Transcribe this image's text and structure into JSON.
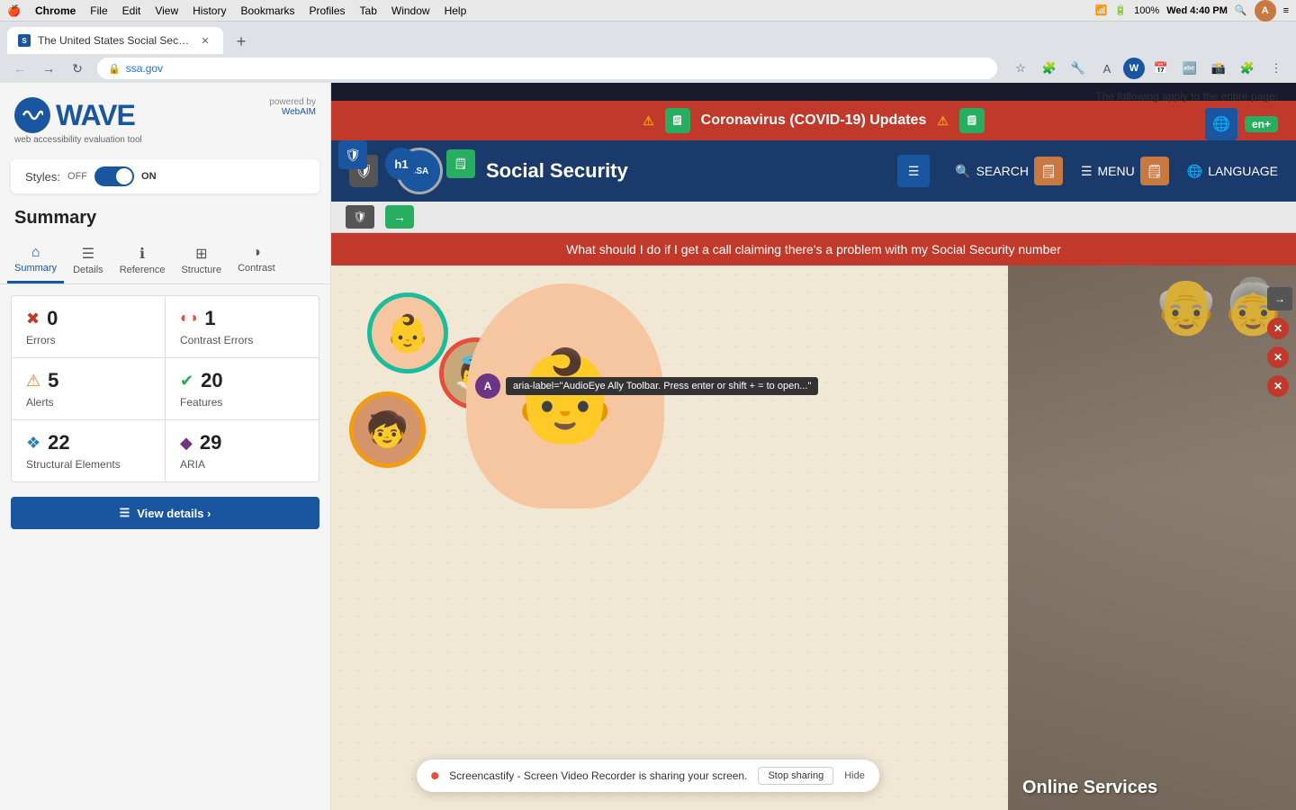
{
  "mac_menubar": {
    "apple": "🍎",
    "app_name": "Chrome",
    "menu_items": [
      "File",
      "Edit",
      "View",
      "History",
      "Bookmarks",
      "Profiles",
      "Tab",
      "Window",
      "Help"
    ],
    "right_icons": [
      "wifi",
      "battery",
      "time"
    ],
    "battery_pct": "100%",
    "time": "Wed 4:40 PM"
  },
  "browser": {
    "tab_title": "The United States Social Secu...",
    "tab_favicon": "SSA",
    "url": "ssa.gov",
    "new_tab_label": "+"
  },
  "wave_sidebar": {
    "logo_letter": "W",
    "logo_text": "WAVE",
    "subtitle": "web accessibility evaluation tool",
    "powered_by": "powered by",
    "webaim_link": "WebAIM",
    "styles_label": "Styles:",
    "styles_off": "OFF",
    "styles_on": "ON",
    "summary_title": "Summary",
    "tabs": [
      {
        "id": "summary",
        "label": "Summary",
        "icon": "⌂",
        "active": true
      },
      {
        "id": "details",
        "label": "Details",
        "icon": "☰"
      },
      {
        "id": "reference",
        "label": "Reference",
        "icon": "ℹ"
      },
      {
        "id": "structure",
        "label": "Structure",
        "icon": "⊞"
      },
      {
        "id": "contrast",
        "label": "Contrast",
        "icon": "◑"
      }
    ],
    "stats": [
      {
        "id": "errors",
        "icon": "✖",
        "icon_class": "icon-error",
        "count": "0",
        "label": "Errors"
      },
      {
        "id": "contrast_errors",
        "icon": "◐",
        "icon_class": "icon-contrast",
        "count": "1",
        "label": "Contrast Errors"
      },
      {
        "id": "alerts",
        "icon": "⚠",
        "icon_class": "icon-alert",
        "count": "5",
        "label": "Alerts"
      },
      {
        "id": "features",
        "icon": "✔",
        "icon_class": "icon-feature",
        "count": "20",
        "label": "Features"
      },
      {
        "id": "structural",
        "icon": "❖",
        "icon_class": "icon-structure",
        "count": "22",
        "label": "Structural Elements"
      },
      {
        "id": "aria",
        "icon": "◆",
        "icon_class": "icon-aria",
        "count": "29",
        "label": "ARIA"
      }
    ],
    "view_details_label": "View details ›"
  },
  "website": {
    "covid_text": "Coronavirus (COVID-19) Updates",
    "ssa_title": "Social Security",
    "nav_items": [
      "SEARCH",
      "MENU",
      "LANGUAGE"
    ],
    "alert_text": "What should I do if I get a call claiming there's a problem with my Social Security number",
    "online_services_label": "Online Services"
  },
  "screencastify": {
    "message": "Screencastify - Screen Video Recorder is sharing your screen.",
    "stop_label": "Stop sharing",
    "hide_label": "Hide"
  },
  "global_page_note": "The following apply to the entire page:"
}
